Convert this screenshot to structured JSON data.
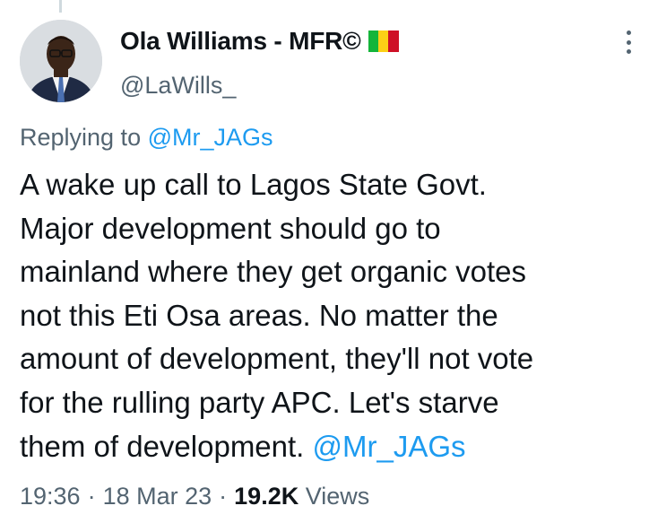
{
  "author": {
    "display_name": "Ola Williams - MFR©",
    "handle": "@LaWills_",
    "flag_colors": [
      "#14b53a",
      "#fcd116",
      "#ce1126"
    ]
  },
  "reply": {
    "prefix": "Replying to ",
    "mention": "@Mr_JAGs"
  },
  "body": {
    "text": "A wake up call to Lagos State Govt.\nMajor development should go to\nmainland where they get organic votes\nnot this Eti Osa areas. No matter the\namount of development, they'll not vote\nfor the rulling party APC. Let's starve\nthem of development. ",
    "trailing_mention": "@Mr_JAGs"
  },
  "meta": {
    "time": "19:36",
    "separator": "·",
    "date": "18 Mar 23",
    "views_count": "19.2K",
    "views_label": "Views"
  },
  "colors": {
    "link": "#1d9bf0",
    "secondary_text": "#536471",
    "primary_text": "#0f1419"
  },
  "icons": {
    "more": "more-vertical-icon"
  }
}
